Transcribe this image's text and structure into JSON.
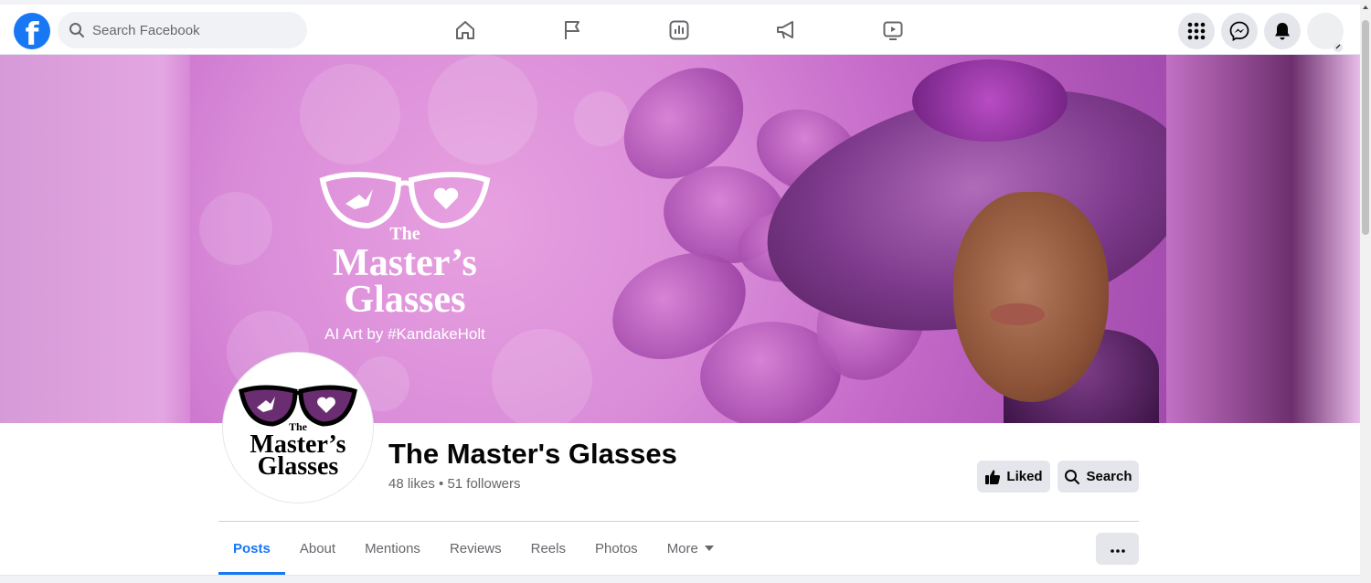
{
  "topbar": {
    "logo": "f",
    "search_placeholder": "Search Facebook",
    "nav_icons": [
      "home-icon",
      "flag-icon",
      "insights-icon",
      "megaphone-icon",
      "video-icon"
    ],
    "right_icons": [
      "menu-grid-icon",
      "messenger-icon",
      "bell-icon",
      "account-avatar"
    ]
  },
  "cover": {
    "logo_the": "The",
    "logo_title_line1": "Master’s",
    "logo_title_line2": "Glasses",
    "logo_subtitle": "AI Art by #KandakeHolt"
  },
  "profile": {
    "logo_the": "The",
    "logo_line1": "Master’s",
    "logo_line2": "Glasses"
  },
  "page": {
    "name": "The Master's Glasses",
    "stats": "48 likes • 51 followers"
  },
  "actions": {
    "liked_label": "Liked",
    "search_label": "Search"
  },
  "tabs": [
    {
      "label": "Posts",
      "active": true
    },
    {
      "label": "About"
    },
    {
      "label": "Mentions"
    },
    {
      "label": "Reviews"
    },
    {
      "label": "Reels"
    },
    {
      "label": "Photos"
    },
    {
      "label": "More"
    }
  ],
  "colors": {
    "accent": "#1877f2",
    "button_bg": "#e4e6eb",
    "secondary_text": "#65676b"
  }
}
